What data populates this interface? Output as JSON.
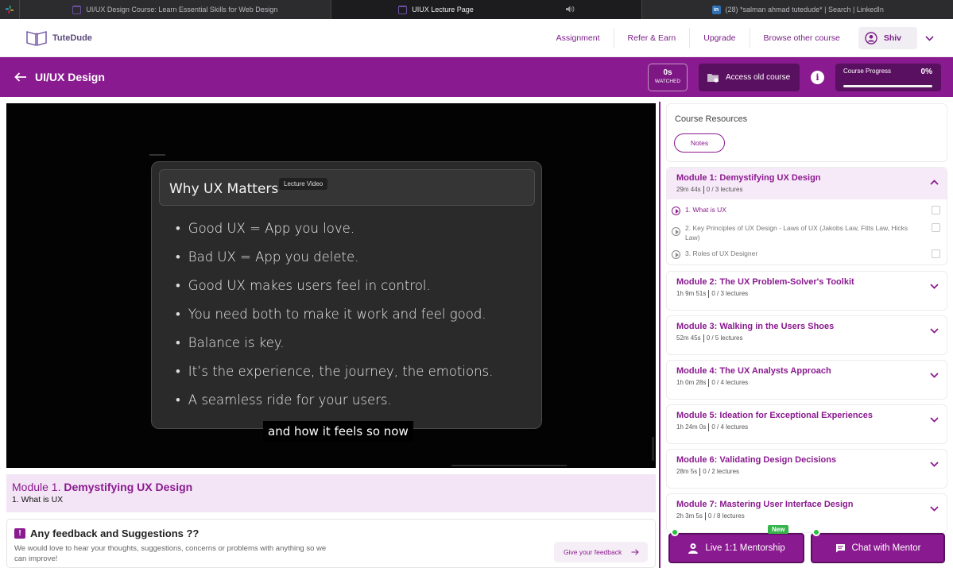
{
  "browser": {
    "tabs": [
      {
        "title": "UI/UX Design Course: Learn Essential Skills for Web Design",
        "active": false
      },
      {
        "title": "UIUX Lecture Page",
        "active": true
      },
      {
        "title": "(28) *salman ahmad tutedude* | Search | LinkedIn",
        "active": false
      }
    ],
    "linkedin_icon": "in"
  },
  "nav": {
    "logo_text": "TuteDude",
    "links": [
      "Assignment",
      "Refer & Earn",
      "Upgrade",
      "Browse other course"
    ],
    "user_name": "Shiv"
  },
  "header": {
    "course_title": "UI/UX Design",
    "watched_value": "0s",
    "watched_label": "WATCHED",
    "access_old_label": "Access old course",
    "info_icon_text": "i",
    "progress_label": "Course Progress",
    "progress_text": "0%",
    "progress_fraction": 0
  },
  "video": {
    "slide_title": "Why UX Matters",
    "tag": "Lecture Video",
    "bullets": [
      "Good UX = App you love.",
      "Bad UX = App you delete.",
      "Good UX makes users feel in control.",
      "You need both to make it work and feel good.",
      "Balance is key.",
      "It’s the experience, the journey, the emotions.",
      "A seamless ride for your users."
    ],
    "caption": "and how it feels so now"
  },
  "lecture": {
    "module_prefix": "Module 1.",
    "module_name": "Demystifying UX Design",
    "lecture_name": "1. What is UX"
  },
  "feedback": {
    "title": "Any feedback and Suggestions ??",
    "text": "We would love to hear your thoughts, suggestions, concerns or problems with anything so we can improve!",
    "button": "Give your feedback",
    "icon_text": "!"
  },
  "resources": {
    "title": "Course Resources",
    "notes_button": "Notes"
  },
  "modules": [
    {
      "title": "Module 1: Demystifying UX Design",
      "duration": "29m 44s",
      "lectures_count": "0 / 3 lectures",
      "open": true,
      "lectures": [
        {
          "title": "1. What is UX",
          "current": true
        },
        {
          "title": "2. Key Principles of UX Design - Laws of UX (Jakobs Law, Fitts Law, Hicks Law)",
          "current": false
        },
        {
          "title": "3. Roles of UX Designer",
          "current": false
        }
      ]
    },
    {
      "title": "Module 2: The UX Problem-Solver's Toolkit",
      "duration": "1h 9m 51s",
      "lectures_count": "0 / 3 lectures"
    },
    {
      "title": "Module 3: Walking in the Users Shoes",
      "duration": "52m 45s",
      "lectures_count": "0 / 5 lectures"
    },
    {
      "title": "Module 4: The UX Analysts Approach",
      "duration": "1h 0m 28s",
      "lectures_count": "0 / 4 lectures"
    },
    {
      "title": "Module 5: Ideation for Exceptional Experiences",
      "duration": "1h 24m 0s",
      "lectures_count": "0 / 4 lectures"
    },
    {
      "title": "Module 6: Validating Design Decisions",
      "duration": "28m 5s",
      "lectures_count": "0 / 2 lectures"
    },
    {
      "title": "Module 7: Mastering User Interface Design",
      "duration": "2h 3m 5s",
      "lectures_count": "0 / 8 lectures"
    }
  ],
  "actions": {
    "mentorship_label": "Live 1:1 Mentorship",
    "new_badge": "New",
    "chat_label": "Chat with Mentor"
  },
  "colors": {
    "brand": "#8a1a8f",
    "brand_dark": "#5a1060",
    "progress_fill": "#ffd04a",
    "online": "#28c23a"
  },
  "icons": [
    "slack-icon",
    "book-icon",
    "speaker-icon",
    "linkedin-icon",
    "user-icon",
    "chevron-down-icon",
    "back-arrow-icon",
    "folder-icon",
    "info-icon",
    "play-icon",
    "feedback-icon",
    "arrow-right-icon",
    "mentor-icon",
    "chat-icon"
  ]
}
